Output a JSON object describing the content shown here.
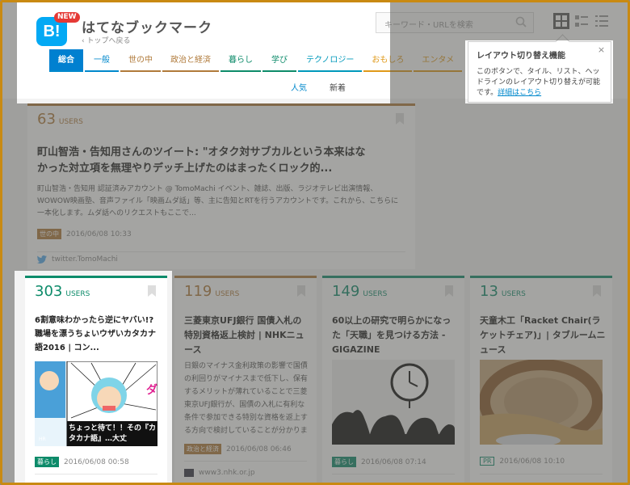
{
  "header": {
    "logo_text": "B!",
    "logo_badge": "NEW",
    "site_title": "はてなブックマーク",
    "back_link": "‹ トップへ戻る",
    "search_placeholder": "キーワード・URLを検索"
  },
  "nav": {
    "tabs": [
      {
        "label": "総合",
        "active": true,
        "color": "#0088cc"
      },
      {
        "label": "一般",
        "active": false,
        "color": "#0088cc"
      },
      {
        "label": "世の中",
        "active": false,
        "color": "#b07a3a"
      },
      {
        "label": "政治と経済",
        "active": false,
        "color": "#b07a3a"
      },
      {
        "label": "暮らし",
        "active": false,
        "color": "#0d8b6a"
      },
      {
        "label": "学び",
        "active": false,
        "color": "#0d8b6a"
      },
      {
        "label": "テクノロジー",
        "active": false,
        "color": "#0099bb"
      },
      {
        "label": "おもしろ",
        "active": false,
        "color": "#e09a1a"
      },
      {
        "label": "エンタメ",
        "active": false,
        "color": "#e09a1a"
      }
    ],
    "subtabs": [
      {
        "label": "人気",
        "current": false
      },
      {
        "label": "新着",
        "current": true
      }
    ]
  },
  "popup": {
    "title": "レイアウト切り替え機能",
    "body": "このボタンで、タイル、リスト、ヘッドラインのレイアウト切り替えが可能です。",
    "link": "詳細はこちら",
    "close": "×"
  },
  "featured": {
    "users": "63",
    "users_label": "USERS",
    "title": "町山智浩・告知用さんのツイート: \"オタク対サブカルという本来はなかった対立項を無理やりデッチ上げたのはまったくロック的...",
    "description": "町山智浩・告知用 認証済みアカウント @ TomoMachi イベント、雑誌、出版、ラジオテレビ出演情報、WOWOW映画塾、音声ファイル「映画ムダ話」等、主に告知とRTを行うアカウントです。これから、こちらに一本化します。ムダ話へのリクエストもここで...",
    "category": "世の中",
    "date": "2016/06/08 10:33",
    "source": "twitter.TomoMachi"
  },
  "cards": [
    {
      "users": "303",
      "users_label": "USERS",
      "title": "6割意味わかったら逆にヤバい!?職場を漂うちょいウザいカタカナ語2016 | コン...",
      "category": "暮らし",
      "date": "2016/06/08 00:58",
      "caption": "ちょっと待て！！その『カタカナ語』…大丈",
      "color": "#0d8b6a"
    },
    {
      "users": "119",
      "users_label": "USERS",
      "title": "三菱東京UFJ銀行 国債入札の特別資格返上検討 | NHKニュース",
      "description": "日銀のマイナス金利政策の影響で国債の利回りがマイナスまで低下し、保有するメリットが薄れていることで三菱東京UFJ銀行が、国債の入札に有利な条件で参加できる特別な資格を返上する方向で検討していることが分かりました。",
      "category": "政治と経済",
      "date": "2016/06/08 06:46",
      "source": "www3.nhk.or.jp",
      "color": "#b07a3a"
    },
    {
      "users": "149",
      "users_label": "USERS",
      "title": "60以上の研究で明らかになった「天職」を見つける方法 - GIGAZINE",
      "category": "暮らし",
      "date": "2016/06/08 07:14",
      "color": "#0d8b6a"
    },
    {
      "users": "13",
      "users_label": "USERS",
      "title": "天童木工「Racket Chair(ラケットチェア)」| タブルームニュース",
      "category": "PR",
      "date": "2016/06/08 10:10",
      "color": "#0d8b6a"
    }
  ]
}
